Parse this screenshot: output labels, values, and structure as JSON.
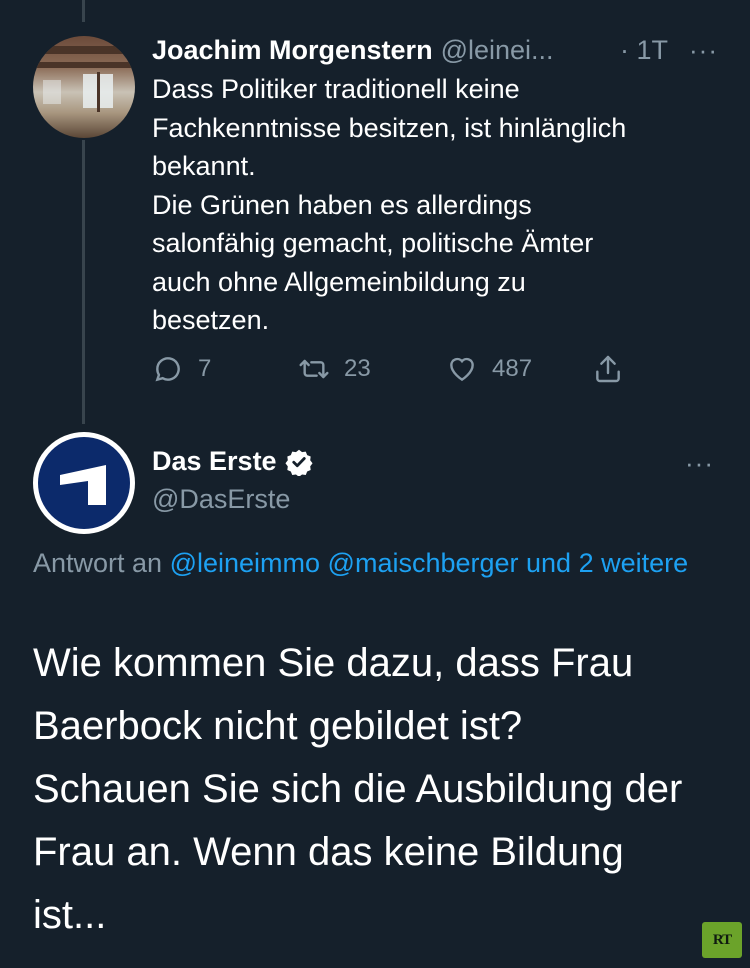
{
  "tweet1": {
    "name": "Joachim Morgenstern",
    "handle": "@leinei...",
    "time": "· 1T",
    "more": "···",
    "text": "Dass Politiker traditionell keine\nFachkenntnisse besitzen, ist hinlänglich\nbekannt.\nDie Grünen haben es allerdings\nsalonfähig gemacht, politische Ämter\nauch ohne Allgemeinbildung zu\nbesetzen.",
    "replies": "7",
    "retweets": "23",
    "likes": "487"
  },
  "tweet2": {
    "name": "Das Erste",
    "handle": "@DasErste",
    "more": "···",
    "reply_prefix": "Antwort an",
    "reply_users": "@leineimmo @maischberger und 2 weitere",
    "text": "Wie kommen Sie dazu, dass Frau\nBaerbock nicht gebildet ist?\nSchauen Sie sich die Ausbildung der\nFrau an. Wenn das keine Bildung\nist..."
  },
  "watermark": {
    "text": "RT",
    "color": "#6ba32a"
  },
  "colors": {
    "background": "#15202b",
    "muted": "#8899a6",
    "link": "#1da1f2",
    "thread_line": "#38444d"
  }
}
